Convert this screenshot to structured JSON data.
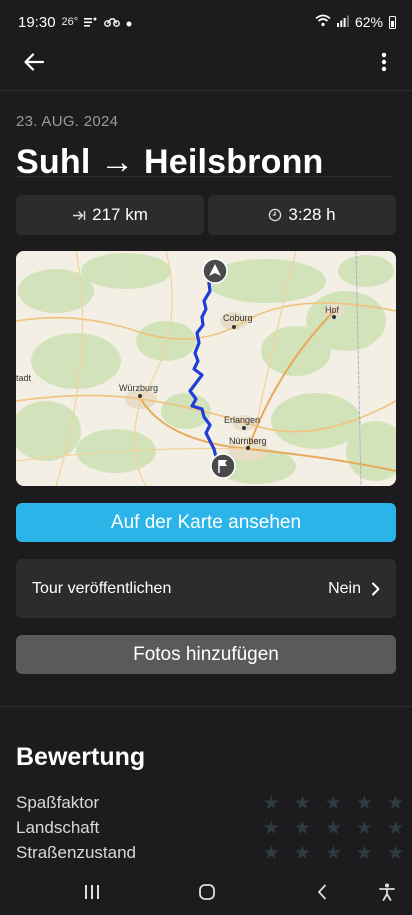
{
  "status_bar": {
    "time": "19:30",
    "temp": "26°",
    "battery": "62%"
  },
  "trip": {
    "date": "23. AUG. 2024",
    "title": "Suhl → Heilsbronn",
    "distance": "217 km",
    "duration": "3:28 h"
  },
  "map": {
    "labels": [
      "Coburg",
      "Hof",
      "tadt",
      "Würzburg",
      "Erlangen",
      "Nürnberg"
    ]
  },
  "actions": {
    "view_on_map": "Auf der Karte ansehen",
    "publish_label": "Tour veröffentlichen",
    "publish_value": "Nein",
    "add_photos": "Fotos hinzufügen"
  },
  "rating": {
    "title": "Bewertung",
    "items": [
      {
        "label": "Spaßfaktor",
        "stars": 0
      },
      {
        "label": "Landschaft",
        "stars": 0
      },
      {
        "label": "Straßenzustand",
        "stars": 0
      }
    ]
  },
  "colors": {
    "accent": "#2ab4e8",
    "route": "#1f3ed8",
    "background": "#1c1c1e",
    "card": "#2c2c2e"
  }
}
